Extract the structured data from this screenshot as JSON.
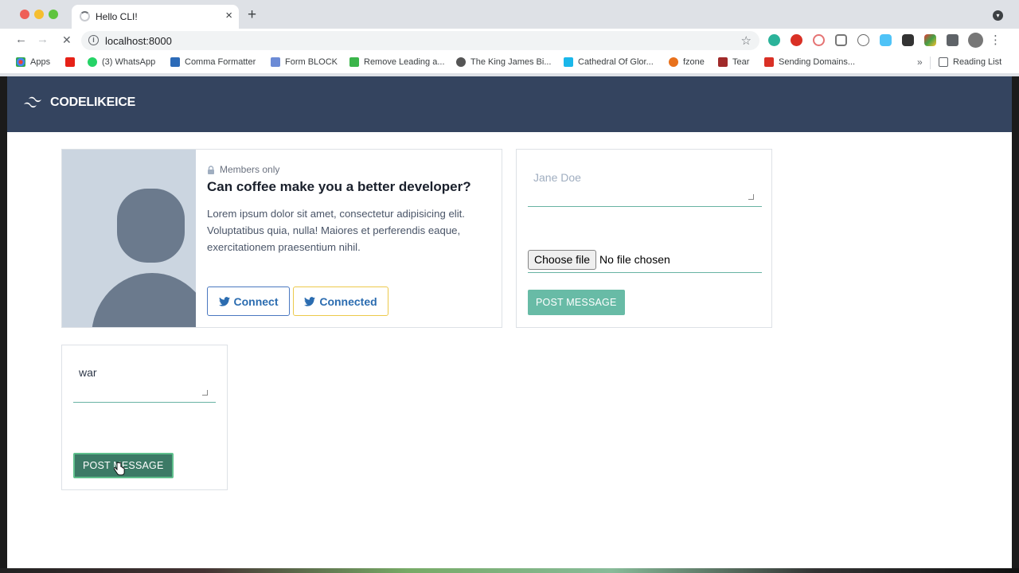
{
  "browser": {
    "tab_title": "Hello CLI!",
    "url": "localhost:8000",
    "bookmarks": [
      {
        "label": "Apps",
        "color": "#ea4335"
      },
      {
        "label": "",
        "color": "#e62117"
      },
      {
        "label": "(3) WhatsApp",
        "color": "#25d366"
      },
      {
        "label": "Comma Formatter",
        "color": "#2c6bb8"
      },
      {
        "label": "Form BLOCK",
        "color": "#6c8bd6"
      },
      {
        "label": "Remove Leading a...",
        "color": "#3bb54a"
      },
      {
        "label": "The King James Bi...",
        "color": "#555555"
      },
      {
        "label": "Cathedral Of Glor...",
        "color": "#1ab7ea"
      },
      {
        "label": "fzone",
        "color": "#e8711c"
      },
      {
        "label": "Tear",
        "color": "#a02a2a"
      },
      {
        "label": "Sending Domains...",
        "color": "#d93025"
      }
    ],
    "reading_list": "Reading List",
    "more": "»"
  },
  "site": {
    "brand": "CODELIKEICE",
    "header_color": "#34445f"
  },
  "card": {
    "badge": "Members only",
    "title": "Can coffee make you a better developer?",
    "text": "Lorem ipsum dolor sit amet, consectetur adipisicing elit. Voluptatibus quia, nulla! Maiores et perferendis eaque, exercitationem praesentium nihil.",
    "btn_connect": "Connect",
    "btn_connected": "Connected"
  },
  "form_a": {
    "placeholder": "Jane Doe",
    "file_button": "Choose file",
    "file_status": "No file chosen",
    "submit": "POST MESSAGE"
  },
  "form_b": {
    "value": "war",
    "submit": "POST MESSAGE"
  }
}
